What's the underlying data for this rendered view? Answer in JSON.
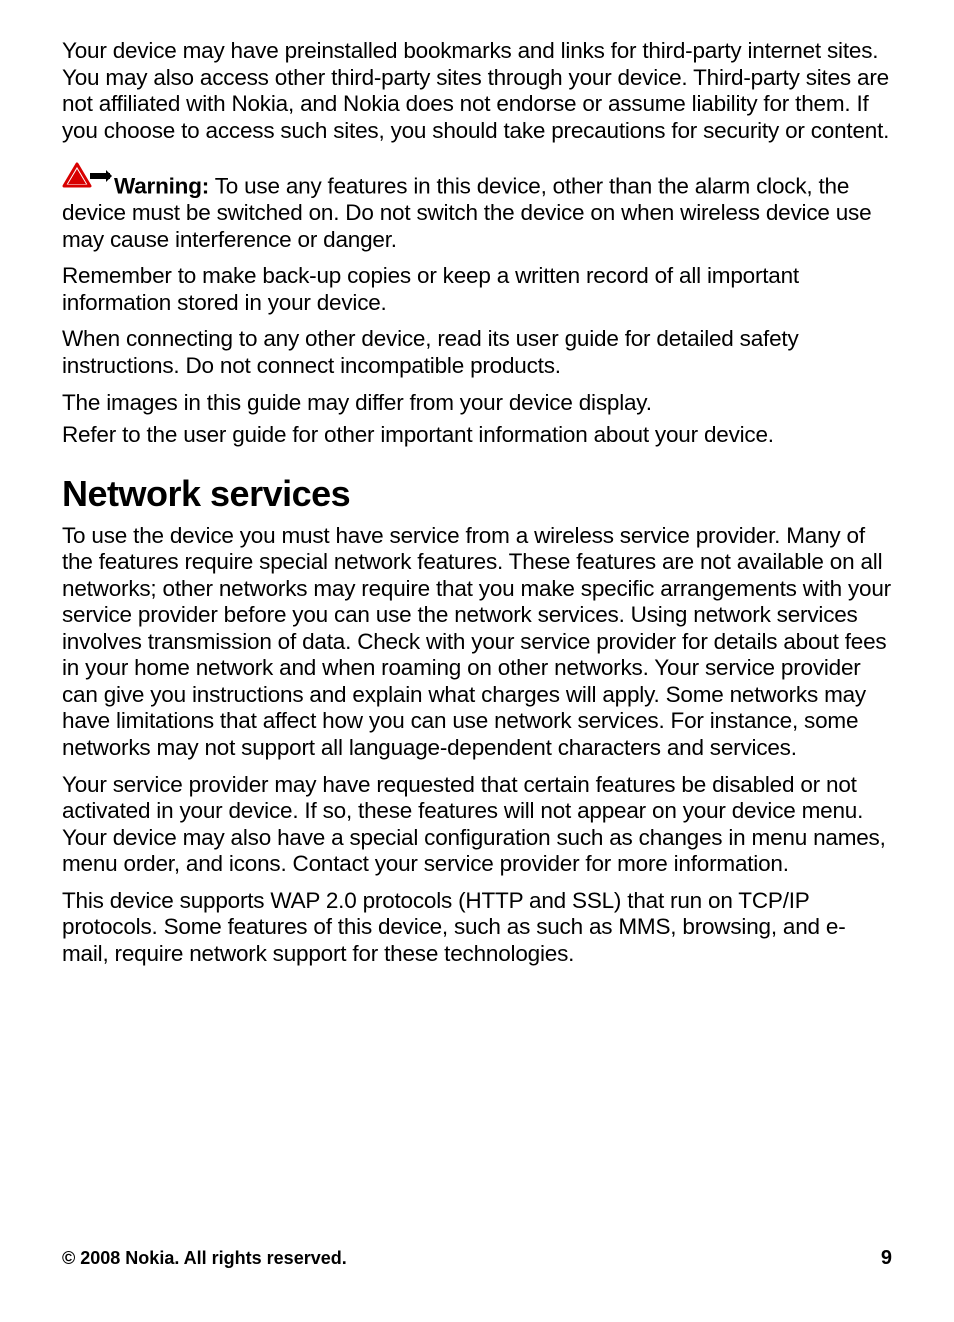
{
  "paragraphs": {
    "p1": "Your device may have preinstalled bookmarks and links for third-party internet sites. You may also access other third-party sites through your device. Third-party sites are not affiliated with Nokia, and Nokia does not endorse or assume liability for them. If you choose to access such sites, you should take precautions for security or content.",
    "warning_label": "Warning:",
    "warning_body": "  To use any features in this device, other than the alarm clock, the device must be switched on. Do not switch the device on when wireless device use may cause interference or danger.",
    "p2": "Remember to make back-up copies or keep a written record of all important information stored in your device.",
    "p3": "When connecting to any other device, read its user guide for detailed safety instructions. Do not connect incompatible products.",
    "p4": "The images in this guide may differ from your device display.",
    "p5": "Refer to the user guide for other important information about your device."
  },
  "section_heading": "Network services",
  "network": {
    "p1": "To use the device you must have service from a wireless service provider. Many of the features require special network features. These features are not available on all networks; other networks may require that you make specific arrangements with your service provider before you can use the network services. Using network services involves transmission of data. Check with your service provider for details about fees in your home network and when roaming on other networks. Your service provider can give you instructions and explain what charges will apply. Some networks may have limitations that affect how you can use network services. For instance, some networks may not support all language-dependent characters and services.",
    "p2": "Your service provider may have requested that certain features be disabled or not activated in your device. If so, these features will not appear on your device menu. Your device may also have a special configuration such as changes in menu names, menu order, and icons. Contact your service provider for more information.",
    "p3": "This device supports WAP 2.0 protocols (HTTP and SSL) that run on TCP/IP protocols. Some features of this device, such as such as MMS, browsing, and e-mail, require network support for these technologies."
  },
  "footer": {
    "copyright": "© 2008 Nokia. All rights reserved.",
    "page_number": "9"
  }
}
